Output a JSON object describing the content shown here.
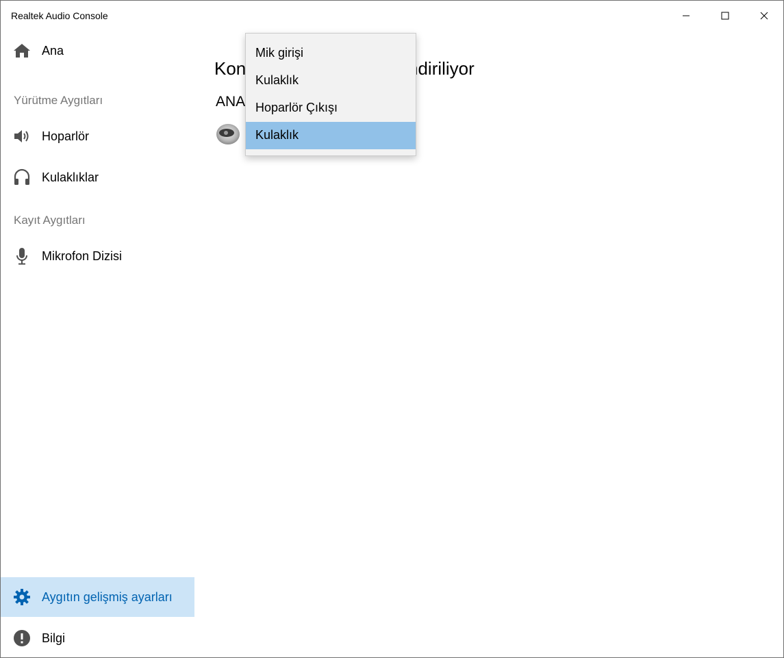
{
  "window": {
    "title": "Realtek Audio Console"
  },
  "sidebar": {
    "home_label": "Ana",
    "playback_header": "Yürütme Aygıtları",
    "playback_items": [
      {
        "label": "Hoparlör",
        "icon": "speaker-icon"
      },
      {
        "label": "Kulaklıklar",
        "icon": "headphones-icon"
      }
    ],
    "recording_header": "Kayıt Aygıtları",
    "recording_items": [
      {
        "label": "Mikrofon Dizisi",
        "icon": "microphone-icon"
      }
    ],
    "bottom_items": [
      {
        "label": "Aygıtın gelişmiş ayarları",
        "icon": "gear-icon",
        "selected": true
      },
      {
        "label": "Bilgi",
        "icon": "info-icon"
      }
    ]
  },
  "main": {
    "title_left": "Kon",
    "title_right": "ndiriliyor",
    "section_label": "ANA"
  },
  "dropdown": {
    "options": [
      {
        "label": "Mik girişi"
      },
      {
        "label": "Kulaklık"
      },
      {
        "label": "Hoparlör Çıkışı"
      },
      {
        "label": "Kulaklık",
        "highlighted": true
      }
    ]
  },
  "colors": {
    "selected_bg": "#cce4f7",
    "selected_text": "#0063b1",
    "highlight_bg": "#91c1e8",
    "popup_bg": "#f2f2f2",
    "section_header": "#767676"
  }
}
